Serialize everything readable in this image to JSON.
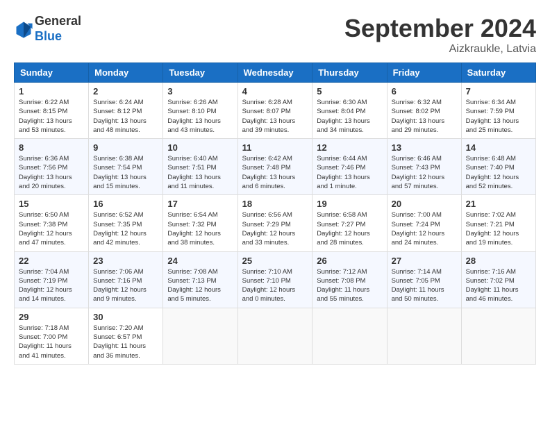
{
  "header": {
    "logo_line1": "General",
    "logo_line2": "Blue",
    "month_title": "September 2024",
    "location": "Aizkraukle, Latvia"
  },
  "weekdays": [
    "Sunday",
    "Monday",
    "Tuesday",
    "Wednesday",
    "Thursday",
    "Friday",
    "Saturday"
  ],
  "weeks": [
    [
      {
        "day": "1",
        "sunrise": "6:22 AM",
        "sunset": "8:15 PM",
        "daylight": "13 hours and 53 minutes."
      },
      {
        "day": "2",
        "sunrise": "6:24 AM",
        "sunset": "8:12 PM",
        "daylight": "13 hours and 48 minutes."
      },
      {
        "day": "3",
        "sunrise": "6:26 AM",
        "sunset": "8:10 PM",
        "daylight": "13 hours and 43 minutes."
      },
      {
        "day": "4",
        "sunrise": "6:28 AM",
        "sunset": "8:07 PM",
        "daylight": "13 hours and 39 minutes."
      },
      {
        "day": "5",
        "sunrise": "6:30 AM",
        "sunset": "8:04 PM",
        "daylight": "13 hours and 34 minutes."
      },
      {
        "day": "6",
        "sunrise": "6:32 AM",
        "sunset": "8:02 PM",
        "daylight": "13 hours and 29 minutes."
      },
      {
        "day": "7",
        "sunrise": "6:34 AM",
        "sunset": "7:59 PM",
        "daylight": "13 hours and 25 minutes."
      }
    ],
    [
      {
        "day": "8",
        "sunrise": "6:36 AM",
        "sunset": "7:56 PM",
        "daylight": "13 hours and 20 minutes."
      },
      {
        "day": "9",
        "sunrise": "6:38 AM",
        "sunset": "7:54 PM",
        "daylight": "13 hours and 15 minutes."
      },
      {
        "day": "10",
        "sunrise": "6:40 AM",
        "sunset": "7:51 PM",
        "daylight": "13 hours and 11 minutes."
      },
      {
        "day": "11",
        "sunrise": "6:42 AM",
        "sunset": "7:48 PM",
        "daylight": "13 hours and 6 minutes."
      },
      {
        "day": "12",
        "sunrise": "6:44 AM",
        "sunset": "7:46 PM",
        "daylight": "13 hours and 1 minute."
      },
      {
        "day": "13",
        "sunrise": "6:46 AM",
        "sunset": "7:43 PM",
        "daylight": "12 hours and 57 minutes."
      },
      {
        "day": "14",
        "sunrise": "6:48 AM",
        "sunset": "7:40 PM",
        "daylight": "12 hours and 52 minutes."
      }
    ],
    [
      {
        "day": "15",
        "sunrise": "6:50 AM",
        "sunset": "7:38 PM",
        "daylight": "12 hours and 47 minutes."
      },
      {
        "day": "16",
        "sunrise": "6:52 AM",
        "sunset": "7:35 PM",
        "daylight": "12 hours and 42 minutes."
      },
      {
        "day": "17",
        "sunrise": "6:54 AM",
        "sunset": "7:32 PM",
        "daylight": "12 hours and 38 minutes."
      },
      {
        "day": "18",
        "sunrise": "6:56 AM",
        "sunset": "7:29 PM",
        "daylight": "12 hours and 33 minutes."
      },
      {
        "day": "19",
        "sunrise": "6:58 AM",
        "sunset": "7:27 PM",
        "daylight": "12 hours and 28 minutes."
      },
      {
        "day": "20",
        "sunrise": "7:00 AM",
        "sunset": "7:24 PM",
        "daylight": "12 hours and 24 minutes."
      },
      {
        "day": "21",
        "sunrise": "7:02 AM",
        "sunset": "7:21 PM",
        "daylight": "12 hours and 19 minutes."
      }
    ],
    [
      {
        "day": "22",
        "sunrise": "7:04 AM",
        "sunset": "7:19 PM",
        "daylight": "12 hours and 14 minutes."
      },
      {
        "day": "23",
        "sunrise": "7:06 AM",
        "sunset": "7:16 PM",
        "daylight": "12 hours and 9 minutes."
      },
      {
        "day": "24",
        "sunrise": "7:08 AM",
        "sunset": "7:13 PM",
        "daylight": "12 hours and 5 minutes."
      },
      {
        "day": "25",
        "sunrise": "7:10 AM",
        "sunset": "7:10 PM",
        "daylight": "12 hours and 0 minutes."
      },
      {
        "day": "26",
        "sunrise": "7:12 AM",
        "sunset": "7:08 PM",
        "daylight": "11 hours and 55 minutes."
      },
      {
        "day": "27",
        "sunrise": "7:14 AM",
        "sunset": "7:05 PM",
        "daylight": "11 hours and 50 minutes."
      },
      {
        "day": "28",
        "sunrise": "7:16 AM",
        "sunset": "7:02 PM",
        "daylight": "11 hours and 46 minutes."
      }
    ],
    [
      {
        "day": "29",
        "sunrise": "7:18 AM",
        "sunset": "7:00 PM",
        "daylight": "11 hours and 41 minutes."
      },
      {
        "day": "30",
        "sunrise": "7:20 AM",
        "sunset": "6:57 PM",
        "daylight": "11 hours and 36 minutes."
      },
      null,
      null,
      null,
      null,
      null
    ]
  ]
}
